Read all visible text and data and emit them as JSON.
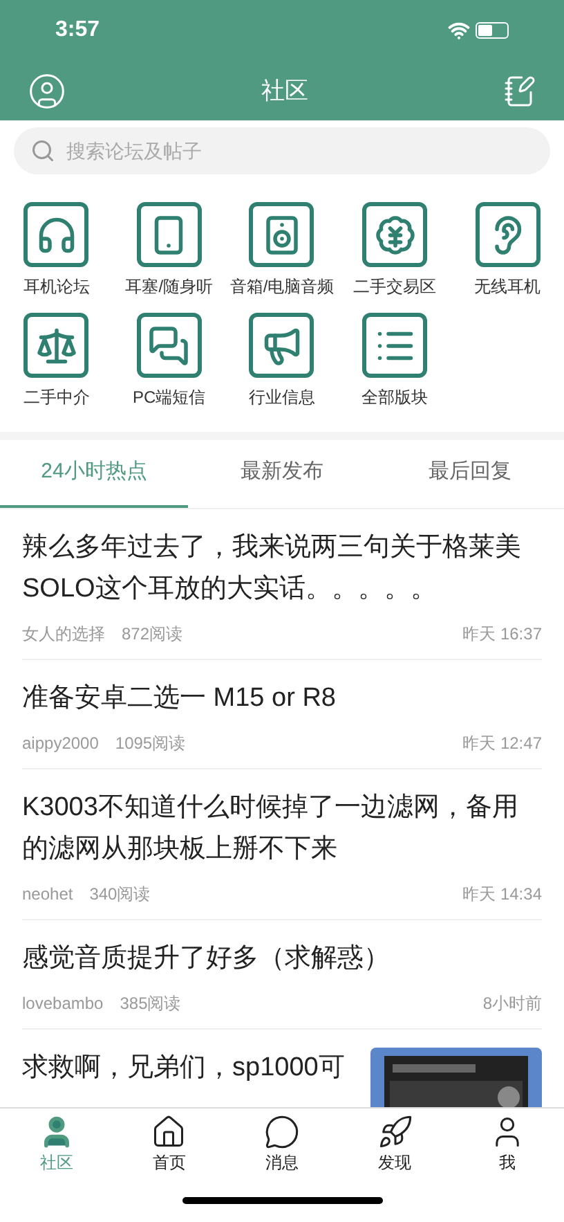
{
  "status_bar": {
    "time": "3:57"
  },
  "header": {
    "title": "社区"
  },
  "search": {
    "placeholder": "搜索论坛及帖子"
  },
  "forums": [
    {
      "label": "耳机论坛"
    },
    {
      "label": "耳塞/随身听"
    },
    {
      "label": "音箱/电脑音频"
    },
    {
      "label": "二手交易区"
    },
    {
      "label": "无线耳机"
    },
    {
      "label": "二手中介"
    },
    {
      "label": "PC端短信"
    },
    {
      "label": "行业信息"
    },
    {
      "label": "全部版块"
    }
  ],
  "tabs": [
    {
      "label": "24小时热点",
      "selected": true
    },
    {
      "label": "最新发布",
      "selected": false
    },
    {
      "label": "最后回复",
      "selected": false
    }
  ],
  "posts": [
    {
      "title": "辣么多年过去了，我来说两三句关于格莱美SOLO这个耳放的大实话。。。。。",
      "author": "女人的选择",
      "reads": "872阅读",
      "time": "昨天 16:37"
    },
    {
      "title": "准备安卓二选一  M15 or R8",
      "author": "aippy2000",
      "reads": "1095阅读",
      "time": "昨天 12:47"
    },
    {
      "title": "K3003不知道什么时候掉了一边滤网，备用的滤网从那块板上掰不下来",
      "author": "neohet",
      "reads": "340阅读",
      "time": "昨天 14:34"
    },
    {
      "title": "感觉音质提升了好多（求解惑）",
      "author": "lovebambo",
      "reads": "385阅读",
      "time": "8小时前"
    },
    {
      "title": "求救啊，兄弟们，sp1000可"
    }
  ],
  "bottom_nav": [
    {
      "label": "社区",
      "selected": true
    },
    {
      "label": "首页",
      "selected": false
    },
    {
      "label": "消息",
      "selected": false
    },
    {
      "label": "发现",
      "selected": false
    },
    {
      "label": "我",
      "selected": false
    }
  ]
}
